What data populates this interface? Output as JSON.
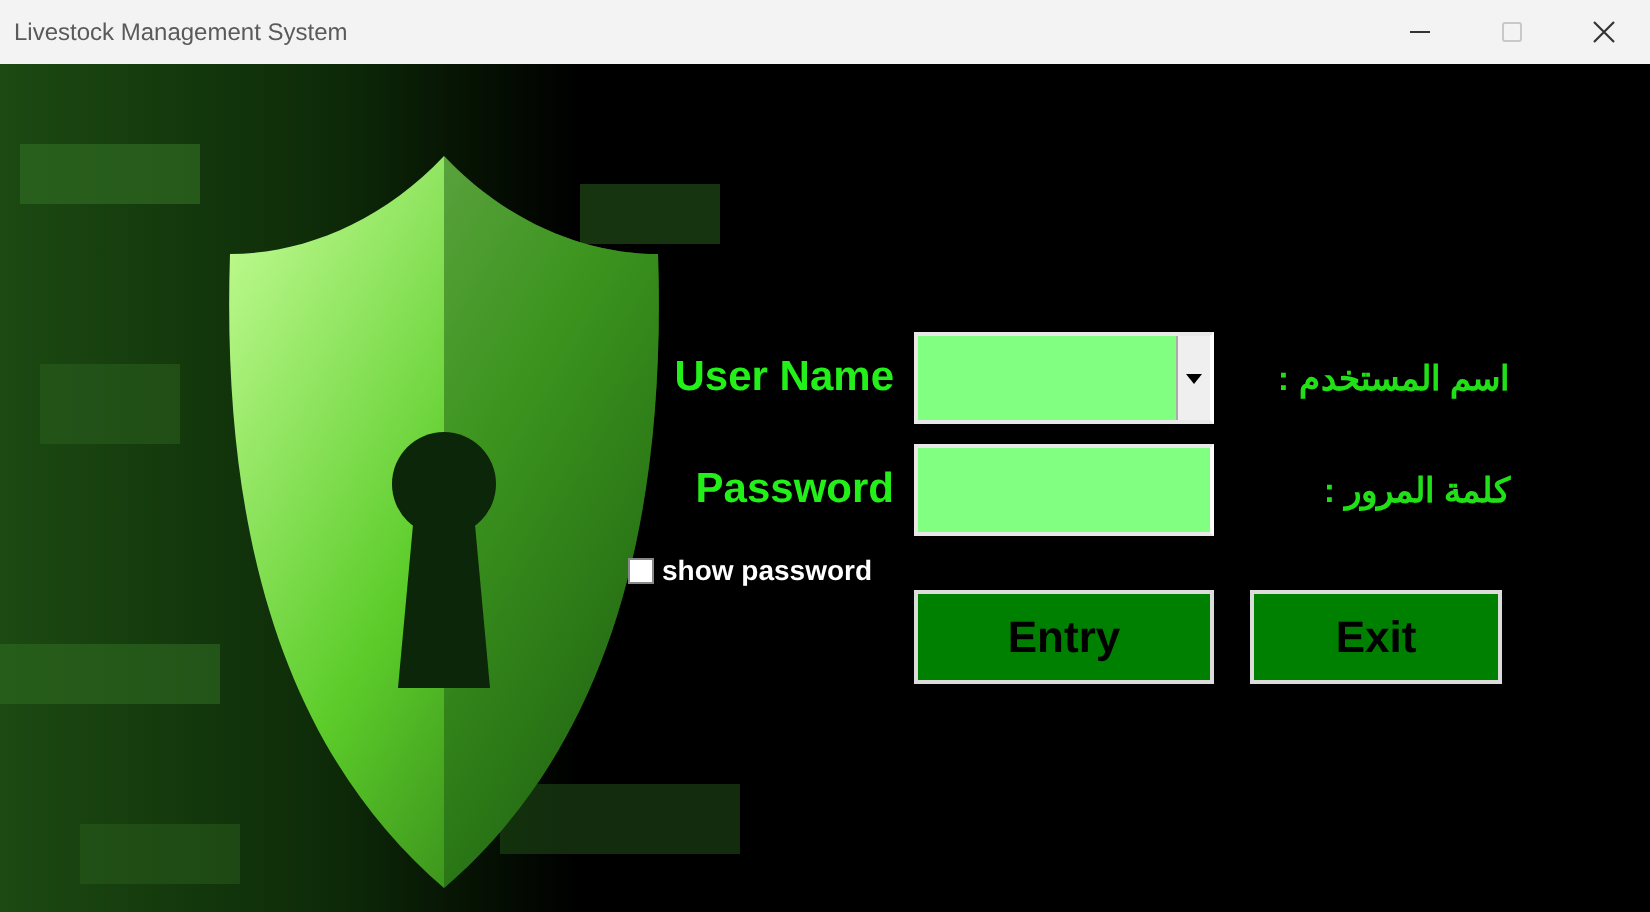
{
  "window": {
    "title": "Livestock Management System",
    "controls": [
      {
        "kind": "minimize",
        "disabled": false
      },
      {
        "kind": "maximize",
        "disabled": true
      },
      {
        "kind": "close",
        "disabled": false
      }
    ]
  },
  "fields": [
    {
      "label": "User Name",
      "label_ar": "اسم المستخدم :",
      "kind": "dropdown"
    },
    {
      "label": "Password",
      "label_ar": "كلمة المرور :",
      "kind": "text"
    }
  ],
  "show_password": {
    "label": "show password",
    "checked": false
  },
  "buttons": [
    "Entry",
    "Exit"
  ]
}
